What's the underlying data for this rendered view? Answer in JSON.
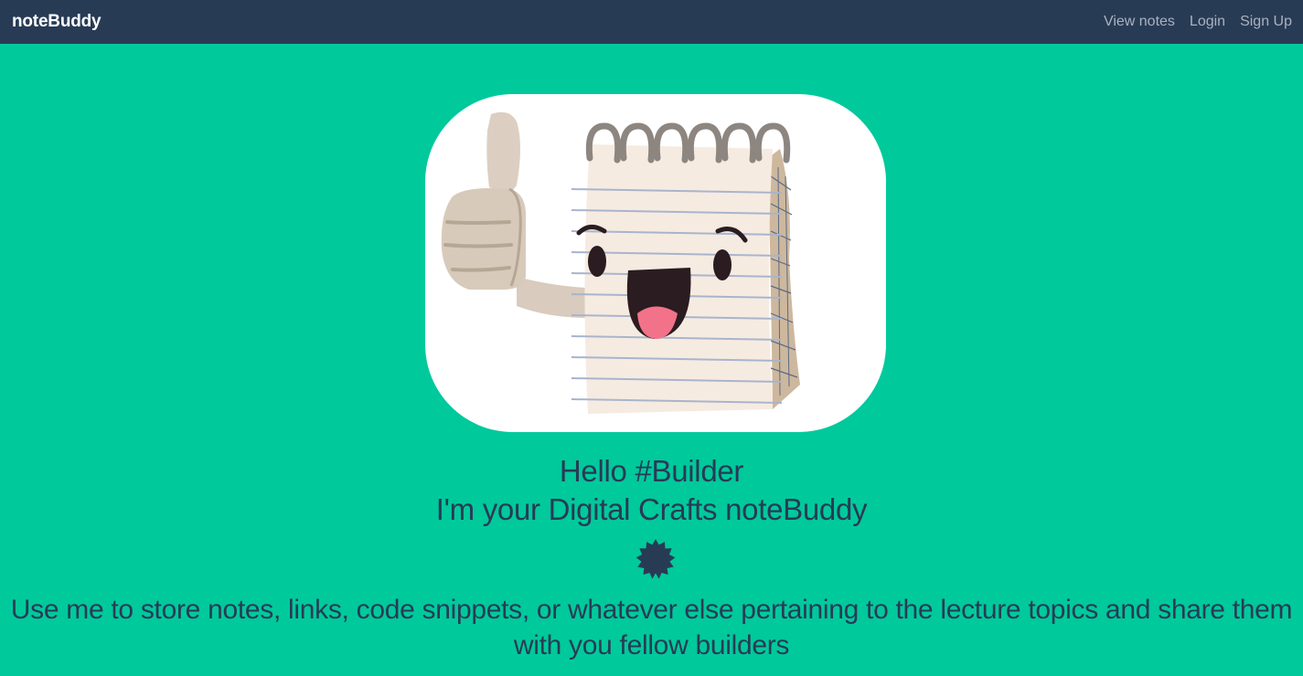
{
  "navbar": {
    "brand": "noteBuddy",
    "links": [
      "View notes",
      "Login",
      "Sign Up"
    ]
  },
  "hero": {
    "image_icon": "notepad-thumbs-up-mascot-icon",
    "greeting": "Hello #Builder",
    "tagline": "I'm your Digital Crafts noteBuddy",
    "badge_icon": "starburst-badge-icon",
    "description": "Use me to store notes, links, code snippets, or whatever else pertaining to the lecture topics and share them with you fellow builders"
  },
  "colors": {
    "background": "#00c99c",
    "navbar": "#283b55",
    "text": "#283b55",
    "nav_link": "#a9b2bf"
  }
}
